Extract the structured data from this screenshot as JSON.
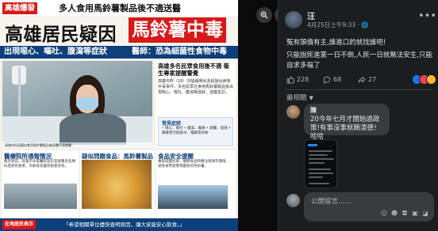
{
  "viewer": {
    "zoom_in_icon": "zoom-in-icon",
    "zoom_out_icon": "zoom-out-icon"
  },
  "poster": {
    "tag": "高雄爆發",
    "subhead": "多人食用馬鈴薯製品後不適送醫",
    "headline_a": "高雄居民疑因",
    "headline_b": "馬鈴薯中毒",
    "band_left": "出現噁心、嘔吐、腹瀉等症狀",
    "band_right": "醫師：恐為細菌性食物中毒",
    "info_title": "高雄多名民眾食用後不適 衛生專家提醒警覺",
    "info_body": "高雄市昨（18）日陸續傳出多起疑似食物中毒事件，多名民眾在食用馬鈴薯製品後出現噁心、嘔吐、腹瀉等症狀，送醫急診。",
    "photo_caption": "高雄市民因疑似食用馬鈴薯製品後身體不適就醫",
    "symptoms_title": "常見症狀",
    "symptoms_body": "• 噁心、嘔吐 • 腹瀉、腹痛 • 頭暈、發燒 • 嚴重者可能脫水、電解質失衡",
    "box1_title": "醫療院所通報情況",
    "box1_body": "截至目前，高雄市多家醫院急診室接獲多名類似症狀的患者，年齡從孩童到長者皆有。",
    "box2_title": "疑似問題食品：馬鈴薯製品",
    "box3_title": "食品安全提醒",
    "box3_body": "專家提醒民眾，購買食品時應注意保存期限，避免食用發芽或變色的馬鈴薯。",
    "bottom_tag": "在地居民表示",
    "bottom_text": "「希望相關單位儘快查明原因，讓大家能安心飲食。」"
  },
  "post": {
    "author": "汪",
    "meta": "4月25日上午9:33 · 🌐",
    "lines": [
      "冤有頭債有主,誰進口的就找誰吧!",
      "只能說民進黨一日不倒,人民一日就無法安生,只能自求多福了"
    ],
    "more_icon": "more-options-icon"
  },
  "reactions": {
    "likes": "228",
    "comments": "68",
    "shares": "27",
    "like_icon": "like-icon",
    "comment_icon": "comment-icon",
    "share_icon": "share-icon"
  },
  "comments": {
    "sort_label": "最相關",
    "reply_author": "陳",
    "reply_text": "20今年七月才開始過政策!有事沒事就賴清德！哈哈",
    "input_placeholder": "公開留言……"
  },
  "colors": {
    "accent": "#1877f2",
    "poster_red": "#d71919",
    "poster_blue": "#0d3f7a",
    "panel_bg": "#1c1d1f",
    "bubble_bg": "#3a3b3c"
  }
}
